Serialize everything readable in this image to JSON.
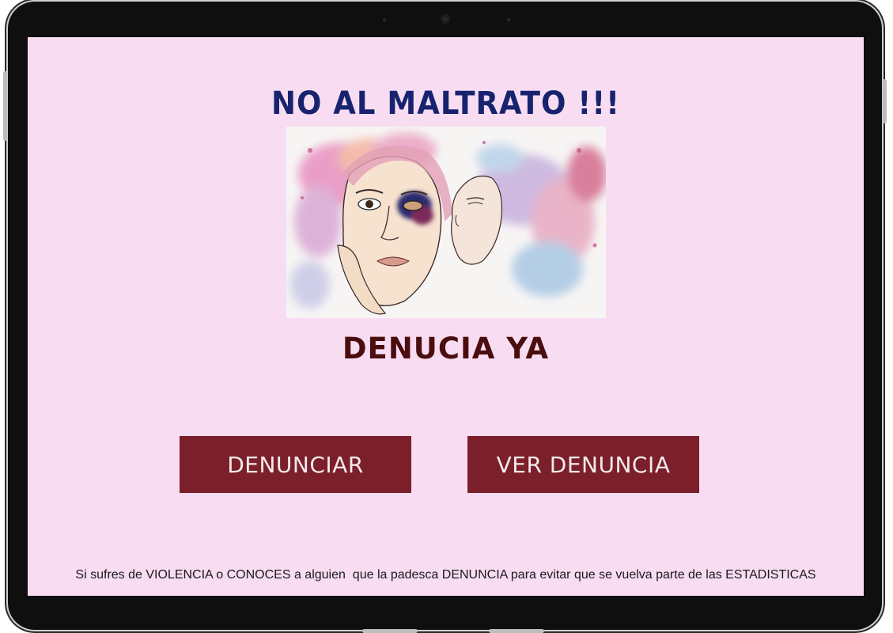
{
  "screen": {
    "title": "NO AL MALTRATO !!!",
    "subtitle": "DENUCIA YA",
    "buttons": {
      "report_label": "DENUNCIAR",
      "view_label": "VER DENUNCIA"
    },
    "footer_text": "Si sufres de VIOLENCIA o CONOCES a alguien  que la padesca DENUNCIA para evitar que se vuelva parte de las ESTADISTICAS"
  },
  "colors": {
    "background": "#f8dcf2",
    "title": "#17236e",
    "subtitle": "#4a0e0e",
    "button": "#7b1f2b",
    "button_text": "#f4eaea"
  }
}
